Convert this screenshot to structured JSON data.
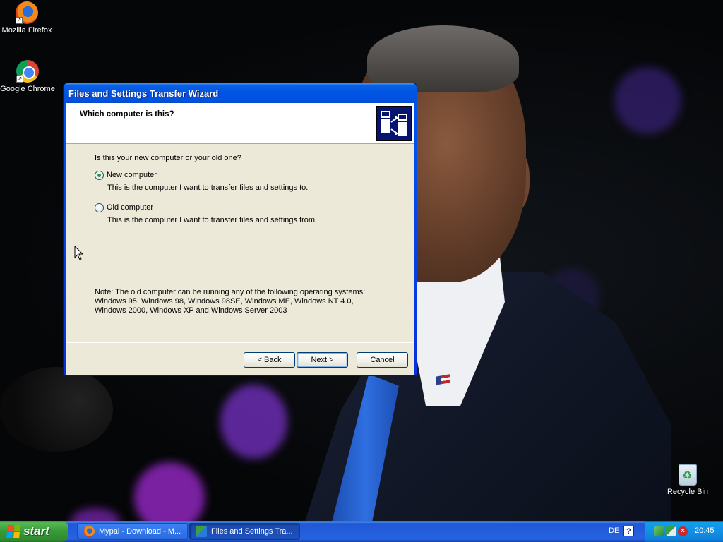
{
  "desktop": {
    "icons": [
      {
        "label": "Mozilla Firefox",
        "icon": "firefox-icon"
      },
      {
        "label": "Google Chrome",
        "icon": "chrome-icon"
      },
      {
        "label": "Recycle Bin",
        "icon": "recycle-bin-icon"
      }
    ]
  },
  "wizard": {
    "title": "Files and Settings Transfer Wizard",
    "heading": "Which computer is this?",
    "question": "Is this your new computer or your old one?",
    "options": [
      {
        "label": "New computer",
        "description": "This is the computer I want to transfer files and settings to.",
        "checked": true
      },
      {
        "label": "Old computer",
        "description": "This is the computer I want to transfer files and settings from.",
        "checked": false
      }
    ],
    "note_line1": "Note: The old computer can be running any of the following operating systems:",
    "note_line2": "Windows 95, Windows 98, Windows 98SE, Windows ME, Windows NT 4.0,",
    "note_line3": "Windows 2000, Windows XP and Windows Server 2003",
    "buttons": {
      "back": "< Back",
      "next": "Next >",
      "cancel": "Cancel"
    }
  },
  "taskbar": {
    "start_label": "start",
    "tasks": [
      {
        "label": "Mypal - Download - M...",
        "icon": "mypal-icon",
        "active": false
      },
      {
        "label": "Files and Settings Tra...",
        "icon": "transfer-wizard-icon",
        "active": true
      }
    ],
    "language": "DE",
    "help_glyph": "?",
    "clock": "20:45"
  },
  "colors": {
    "titlebar_blue": "#0054e3",
    "dialog_face": "#ece9d8",
    "start_green": "#379a37",
    "taskbar_blue": "#2663e0"
  }
}
